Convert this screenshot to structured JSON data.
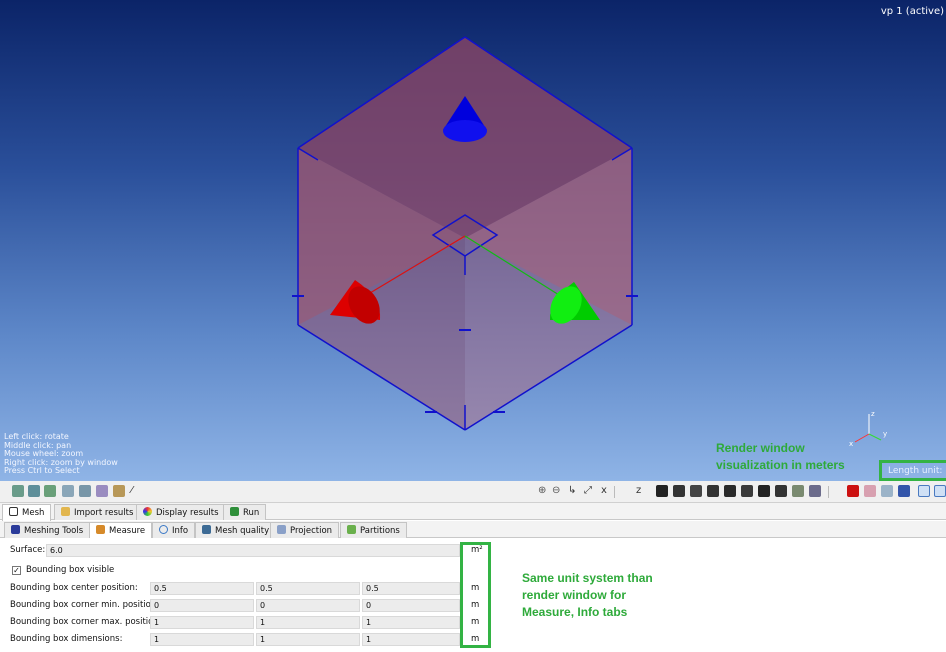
{
  "viewport": {
    "label": "vp 1 (active)",
    "hints": [
      "Left click: rotate",
      "Middle click: pan",
      "Mouse wheel: zoom",
      "Right click: zoom by window",
      "Press Ctrl to Select"
    ],
    "length_unit": "Length unit: m",
    "axis_labels": {
      "x": "x",
      "y": "y",
      "z": "z"
    },
    "background_top": "#0b2468",
    "background_bottom": "#8fb4e6",
    "cube_face_color": "#a35a72",
    "cube_edge_color": "#1111cc",
    "cone_colors": {
      "z": "#0000dd",
      "x": "#ee0000",
      "y": "#00dd00"
    }
  },
  "annotations": {
    "render_note": [
      "Render window",
      "visualization in meters"
    ],
    "measure_note": [
      "Same unit system than",
      "render window for",
      "Measure, Info tabs"
    ],
    "highlight_color": "#33b344"
  },
  "toolbar": {
    "left_icons": [
      "mesh-tool-icon",
      "mesh-tool-icon",
      "mesh-tool-icon",
      "mesh-tool-icon",
      "mesh-tool-icon",
      "mesh-tool-icon",
      "mesh-tool-icon",
      "wand-icon"
    ],
    "right_glyphs": {
      "x_label": "x",
      "z_label": "z"
    }
  },
  "main_tabs": [
    {
      "label": "Mesh",
      "icon": "grid-icon"
    },
    {
      "label": "Import results",
      "icon": "folder-icon"
    },
    {
      "label": "Display results",
      "icon": "palette-icon"
    },
    {
      "label": "Run",
      "icon": "run-icon"
    }
  ],
  "sub_tabs": [
    {
      "label": "Meshing Tools",
      "icon": "cube-icon"
    },
    {
      "label": "Measure",
      "icon": "ruler-icon"
    },
    {
      "label": "Info",
      "icon": "magnifier-icon"
    },
    {
      "label": "Mesh quality",
      "icon": "quality-icon"
    },
    {
      "label": "Projection",
      "icon": "projection-icon"
    },
    {
      "label": "Partitions",
      "icon": "partitions-icon"
    }
  ],
  "measure": {
    "surface_label": "Surface:",
    "surface_value": "6.0",
    "surface_unit": "m²",
    "bbox_visible_label": "Bounding box visible",
    "bbox_visible_checked": "✓",
    "rows": [
      {
        "label": "Bounding box center position:",
        "values": [
          "0.5",
          "0.5",
          "0.5"
        ],
        "unit": "m"
      },
      {
        "label": "Bounding box corner min. position:",
        "values": [
          "0",
          "0",
          "0"
        ],
        "unit": "m"
      },
      {
        "label": "Bounding box corner max. position:",
        "values": [
          "1",
          "1",
          "1"
        ],
        "unit": "m"
      },
      {
        "label": "Bounding box dimensions:",
        "values": [
          "1",
          "1",
          "1"
        ],
        "unit": "m"
      }
    ]
  }
}
